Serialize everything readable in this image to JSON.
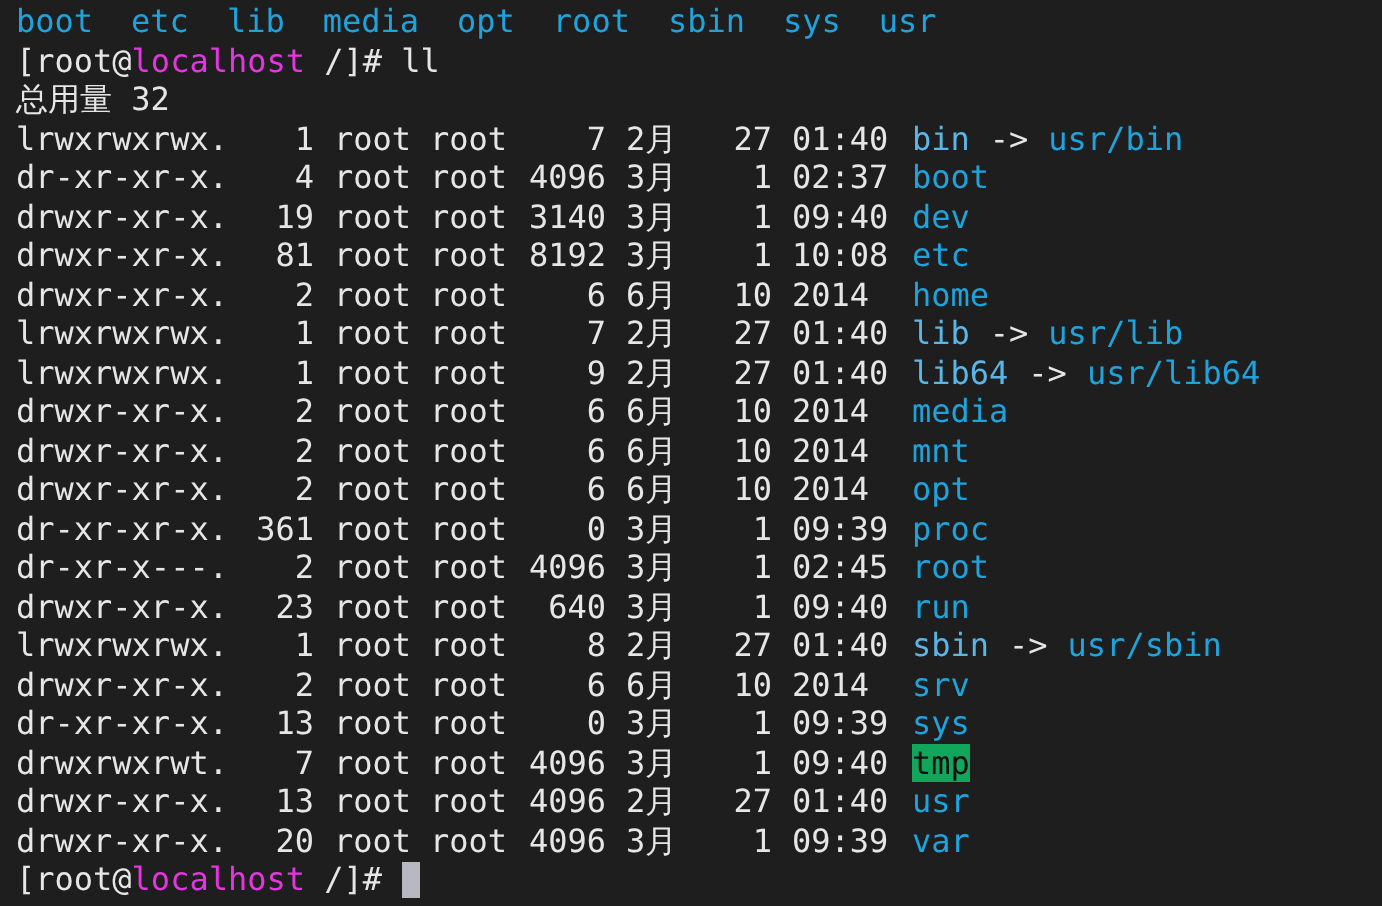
{
  "previous_output": [
    "boot",
    "etc",
    "lib",
    "media",
    "opt",
    "root",
    "sbin",
    "sys",
    "usr"
  ],
  "command_prompt": {
    "open": "[root@",
    "host": "localhost",
    "path": " /]# ",
    "command": "ll"
  },
  "total": "总用量 32",
  "entries": [
    {
      "kind": "link",
      "perms": "lrwxrwxrwx.",
      "links": "1",
      "owner": "root",
      "group": "root",
      "size": "7",
      "month": "2月",
      "day": "27",
      "time": "01:40",
      "name": "bin",
      "arrow": "->",
      "target": "usr/bin"
    },
    {
      "kind": "dir",
      "perms": "dr-xr-xr-x.",
      "links": "4",
      "owner": "root",
      "group": "root",
      "size": "4096",
      "month": "3月",
      "day": "1",
      "time": "02:37",
      "name": "boot"
    },
    {
      "kind": "dir",
      "perms": "drwxr-xr-x.",
      "links": "19",
      "owner": "root",
      "group": "root",
      "size": "3140",
      "month": "3月",
      "day": "1",
      "time": "09:40",
      "name": "dev"
    },
    {
      "kind": "dir",
      "perms": "drwxr-xr-x.",
      "links": "81",
      "owner": "root",
      "group": "root",
      "size": "8192",
      "month": "3月",
      "day": "1",
      "time": "10:08",
      "name": "etc"
    },
    {
      "kind": "dir",
      "perms": "drwxr-xr-x.",
      "links": "2",
      "owner": "root",
      "group": "root",
      "size": "6",
      "month": "6月",
      "day": "10",
      "time": "2014",
      "name": "home"
    },
    {
      "kind": "link",
      "perms": "lrwxrwxrwx.",
      "links": "1",
      "owner": "root",
      "group": "root",
      "size": "7",
      "month": "2月",
      "day": "27",
      "time": "01:40",
      "name": "lib",
      "arrow": "->",
      "target": "usr/lib"
    },
    {
      "kind": "link",
      "perms": "lrwxrwxrwx.",
      "links": "1",
      "owner": "root",
      "group": "root",
      "size": "9",
      "month": "2月",
      "day": "27",
      "time": "01:40",
      "name": "lib64",
      "arrow": "->",
      "target": "usr/lib64"
    },
    {
      "kind": "dir",
      "perms": "drwxr-xr-x.",
      "links": "2",
      "owner": "root",
      "group": "root",
      "size": "6",
      "month": "6月",
      "day": "10",
      "time": "2014",
      "name": "media"
    },
    {
      "kind": "dir",
      "perms": "drwxr-xr-x.",
      "links": "2",
      "owner": "root",
      "group": "root",
      "size": "6",
      "month": "6月",
      "day": "10",
      "time": "2014",
      "name": "mnt"
    },
    {
      "kind": "dir",
      "perms": "drwxr-xr-x.",
      "links": "2",
      "owner": "root",
      "group": "root",
      "size": "6",
      "month": "6月",
      "day": "10",
      "time": "2014",
      "name": "opt"
    },
    {
      "kind": "dir",
      "perms": "dr-xr-xr-x.",
      "links": "361",
      "owner": "root",
      "group": "root",
      "size": "0",
      "month": "3月",
      "day": "1",
      "time": "09:39",
      "name": "proc"
    },
    {
      "kind": "dir",
      "perms": "dr-xr-x---.",
      "links": "2",
      "owner": "root",
      "group": "root",
      "size": "4096",
      "month": "3月",
      "day": "1",
      "time": "02:45",
      "name": "root"
    },
    {
      "kind": "dir",
      "perms": "drwxr-xr-x.",
      "links": "23",
      "owner": "root",
      "group": "root",
      "size": "640",
      "month": "3月",
      "day": "1",
      "time": "09:40",
      "name": "run"
    },
    {
      "kind": "link",
      "perms": "lrwxrwxrwx.",
      "links": "1",
      "owner": "root",
      "group": "root",
      "size": "8",
      "month": "2月",
      "day": "27",
      "time": "01:40",
      "name": "sbin",
      "arrow": "->",
      "target": "usr/sbin"
    },
    {
      "kind": "dir",
      "perms": "drwxr-xr-x.",
      "links": "2",
      "owner": "root",
      "group": "root",
      "size": "6",
      "month": "6月",
      "day": "10",
      "time": "2014",
      "name": "srv"
    },
    {
      "kind": "dir",
      "perms": "dr-xr-xr-x.",
      "links": "13",
      "owner": "root",
      "group": "root",
      "size": "0",
      "month": "3月",
      "day": "1",
      "time": "09:39",
      "name": "sys"
    },
    {
      "kind": "sticky",
      "perms": "drwxrwxrwt.",
      "links": "7",
      "owner": "root",
      "group": "root",
      "size": "4096",
      "month": "3月",
      "day": "1",
      "time": "09:40",
      "name": "tmp"
    },
    {
      "kind": "dir",
      "perms": "drwxr-xr-x.",
      "links": "13",
      "owner": "root",
      "group": "root",
      "size": "4096",
      "month": "2月",
      "day": "27",
      "time": "01:40",
      "name": "usr"
    },
    {
      "kind": "dir",
      "perms": "drwxr-xr-x.",
      "links": "20",
      "owner": "root",
      "group": "root",
      "size": "4096",
      "month": "3月",
      "day": "1",
      "time": "09:39",
      "name": "var"
    }
  ],
  "bottom_prompt": {
    "open": "[root@",
    "host": "localhost",
    "path": " /]# "
  }
}
